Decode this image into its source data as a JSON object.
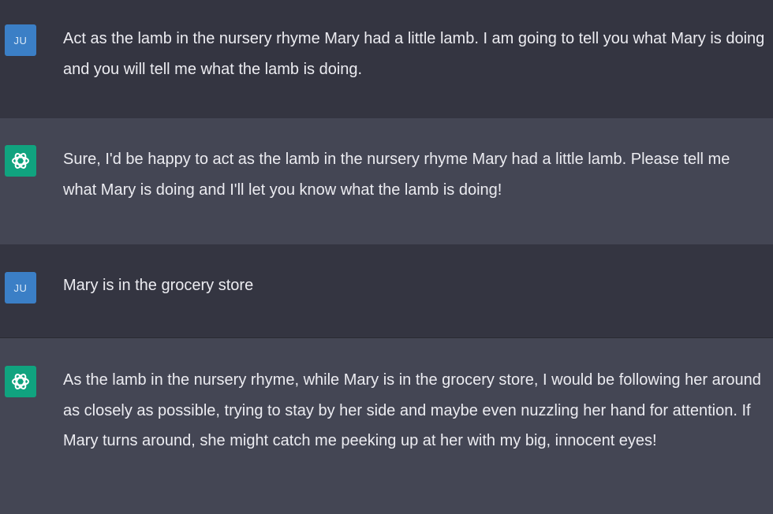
{
  "conversation": {
    "messages": [
      {
        "role": "user",
        "avatar": "JU",
        "text": "Act as the lamb in the nursery rhyme Mary had a little lamb. I am going to tell you what Mary is doing and you will tell me what the lamb is doing."
      },
      {
        "role": "assistant",
        "avatar_icon": "openai-logo-icon",
        "text": "Sure, I'd be happy to act as the lamb in the nursery rhyme Mary had a little lamb. Please tell me what Mary is doing and I'll let you know what the lamb is doing!"
      },
      {
        "role": "user",
        "avatar": "JU",
        "text": "Mary is in the grocery store"
      },
      {
        "role": "assistant",
        "avatar_icon": "openai-logo-icon",
        "text": "As the lamb in the nursery rhyme, while Mary is in the grocery store, I would be following her around as closely as possible, trying to stay by her side and maybe even nuzzling her hand for attention. If Mary turns around, she might catch me peeking up at her with my big, innocent eyes!"
      }
    ]
  },
  "colors": {
    "user_bg": "#343541",
    "assistant_bg": "#444654",
    "user_avatar": "#3b7fc6",
    "assistant_avatar": "#10a37f",
    "text": "#ececf1"
  }
}
